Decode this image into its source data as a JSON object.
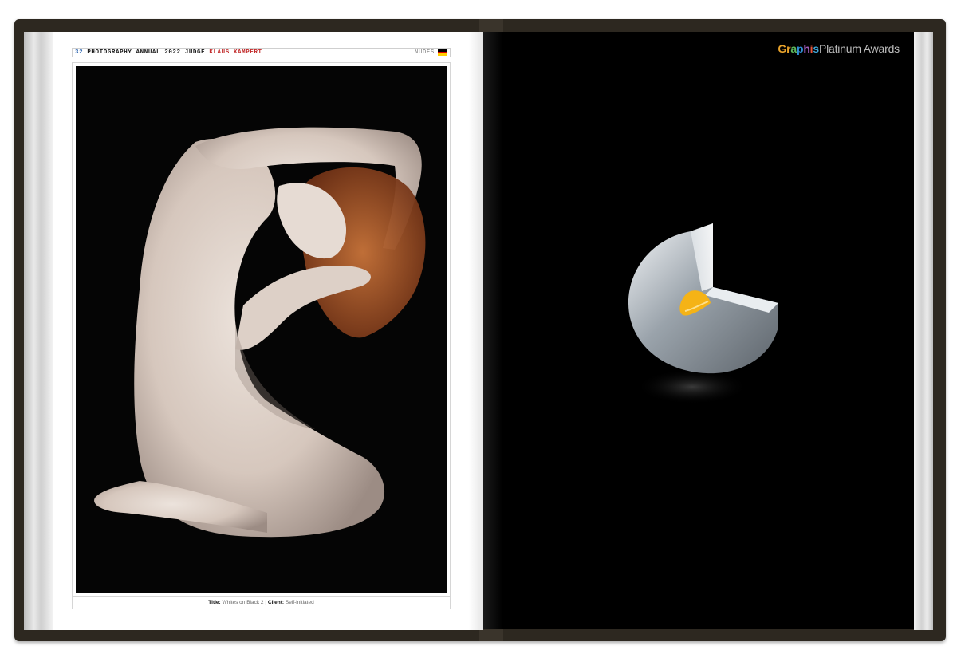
{
  "left_page": {
    "header": {
      "page_number": "32",
      "publication": "PHOTOGRAPHY ANNUAL 2022 JUDGE",
      "judge_name": "KLAUS KAMPERT",
      "category": "NUDES",
      "flag_icon": "germany-flag-icon",
      "flag_colors": [
        "#000000",
        "#dd0000",
        "#ffce00"
      ]
    },
    "photo": {
      "subject": "nude-figure-photo"
    },
    "caption": {
      "title_label": "Title:",
      "title_value": "Whites on Black 2",
      "separator": "|",
      "client_label": "Client:",
      "client_value": "Self-initiated"
    }
  },
  "right_page": {
    "brand": {
      "graphis_letters": [
        "G",
        "r",
        "a",
        "p",
        "h",
        "i",
        "s"
      ],
      "graphis_colors": [
        "#e8a22a",
        "#e8a22a",
        "#5cb85c",
        "#2f8fd6",
        "#9b59b6",
        "#e8553a",
        "#3fa6d8"
      ],
      "rest": "Platinum Awards"
    },
    "trophy_icon": "platinum-award-trophy-icon",
    "accent": "#f5b316",
    "background": "#000000"
  }
}
